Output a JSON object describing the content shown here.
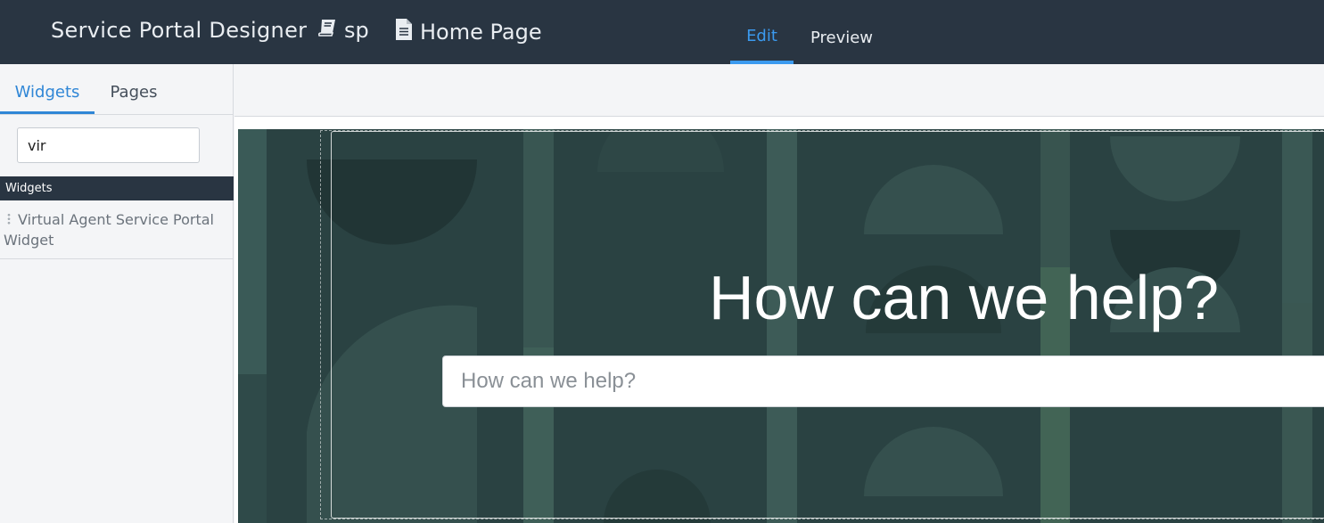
{
  "header": {
    "app_title": "Service Portal Designer",
    "portal_name": "sp",
    "page_name": "Home Page",
    "tabs": [
      {
        "label": "Edit",
        "active": true
      },
      {
        "label": "Preview",
        "active": false
      }
    ]
  },
  "sidebar": {
    "tabs": [
      {
        "label": "Widgets",
        "active": true
      },
      {
        "label": "Pages",
        "active": false
      }
    ],
    "search": {
      "value": "vir"
    },
    "section_title": "Widgets",
    "widgets": [
      {
        "label": "Virtual Agent Service Portal Widget"
      }
    ]
  },
  "hero": {
    "title": "How can we help?",
    "search_placeholder": "How can we help?"
  },
  "colors": {
    "header_bg": "#293542",
    "accent": "#3b9aef",
    "hero_bg": "#2a4242"
  }
}
